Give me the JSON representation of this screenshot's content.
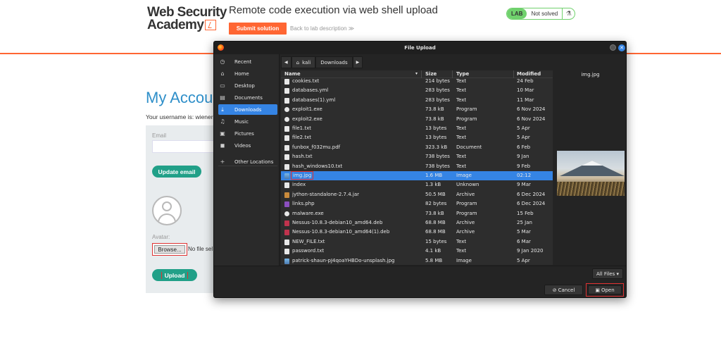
{
  "header": {
    "logo_line1": "Web Security",
    "logo_line2": "Academy",
    "lab_title": "Remote code execution via web shell upload",
    "submit_label": "Submit solution",
    "back_link": "Back to lab description",
    "back_arrow": "≫",
    "lab_tag": "LAB",
    "lab_status": "Not solved",
    "flask_icon": "⚗"
  },
  "account": {
    "title": "My Accou",
    "username_text": "Your username is: wiener",
    "email_label": "Email",
    "update_label": "Update email",
    "avatar_label": "Avatar:",
    "browse_label": "Browse...",
    "no_file_text": "No file sel",
    "upload_label": "Upload"
  },
  "dialog": {
    "title": "File Upload",
    "close_glyph": "✕",
    "sidebar": [
      {
        "icon": "◷",
        "icon_name": "recent-icon",
        "label": "Recent"
      },
      {
        "icon": "⌂",
        "icon_name": "home-icon",
        "label": "Home"
      },
      {
        "icon": "▭",
        "icon_name": "desktop-icon",
        "label": "Desktop"
      },
      {
        "icon": "▤",
        "icon_name": "documents-icon",
        "label": "Documents"
      },
      {
        "icon": "⤓",
        "icon_name": "downloads-icon",
        "label": "Downloads"
      },
      {
        "icon": "♫",
        "icon_name": "music-icon",
        "label": "Music"
      },
      {
        "icon": "▣",
        "icon_name": "pictures-icon",
        "label": "Pictures"
      },
      {
        "icon": "◼",
        "icon_name": "videos-icon",
        "label": "Videos"
      },
      {
        "icon": "+",
        "icon_name": "other-locations-icon",
        "label": "Other Locations"
      }
    ],
    "path": {
      "back": "◀",
      "home_icon": "⌂",
      "home_label": "kali",
      "current": "Downloads",
      "forward": "▶"
    },
    "columns": {
      "name": "Name",
      "size": "Size",
      "type": "Type",
      "modified": "Modified",
      "sort_glyph": "▾"
    },
    "files": [
      {
        "name": "cookies.txt",
        "size": "214 bytes",
        "type": "Text",
        "modified": "24 Feb",
        "icon": "text"
      },
      {
        "name": "databases.yml",
        "size": "283 bytes",
        "type": "Text",
        "modified": "10 Mar",
        "icon": "text"
      },
      {
        "name": "databases(1).yml",
        "size": "283 bytes",
        "type": "Text",
        "modified": "11 Mar",
        "icon": "text"
      },
      {
        "name": "exploit1.exe",
        "size": "73.8 kB",
        "type": "Program",
        "modified": "6 Nov 2024",
        "icon": "gear"
      },
      {
        "name": "exploit2.exe",
        "size": "73.8 kB",
        "type": "Program",
        "modified": "6 Nov 2024",
        "icon": "gear"
      },
      {
        "name": "file1.txt",
        "size": "13 bytes",
        "type": "Text",
        "modified": "5 Apr",
        "icon": "text"
      },
      {
        "name": "file2.txt",
        "size": "13 bytes",
        "type": "Text",
        "modified": "5 Apr",
        "icon": "text"
      },
      {
        "name": "funbox_f032mu.pdf",
        "size": "323.3 kB",
        "type": "Document",
        "modified": "6 Feb",
        "icon": "text"
      },
      {
        "name": "hash.txt",
        "size": "738 bytes",
        "type": "Text",
        "modified": "9 Jan",
        "icon": "text"
      },
      {
        "name": "hash_windows10.txt",
        "size": "738 bytes",
        "type": "Text",
        "modified": "9 Feb",
        "icon": "text"
      },
      {
        "name": "img.jpg",
        "size": "1.6 MB",
        "type": "Image",
        "modified": "02:12",
        "icon": "img"
      },
      {
        "name": "index",
        "size": "1.3 kB",
        "type": "Unknown",
        "modified": "9 Mar",
        "icon": "text"
      },
      {
        "name": "jython-standalone-2.7.4.jar",
        "size": "50.5 MB",
        "type": "Archive",
        "modified": "6 Dec 2024",
        "icon": "arch"
      },
      {
        "name": "links.php",
        "size": "82 bytes",
        "type": "Program",
        "modified": "6 Dec 2024",
        "icon": "php"
      },
      {
        "name": "malware.exe",
        "size": "73.8 kB",
        "type": "Program",
        "modified": "15 Feb",
        "icon": "gear"
      },
      {
        "name": "Nessus-10.8.3-debian10_amd64.deb",
        "size": "68.8 MB",
        "type": "Archive",
        "modified": "25 Jan",
        "icon": "deb"
      },
      {
        "name": "Nessus-10.8.3-debian10_amd64(1).deb",
        "size": "68.8 MB",
        "type": "Archive",
        "modified": "5 Mar",
        "icon": "deb"
      },
      {
        "name": "NEW_FILE.txt",
        "size": "15 bytes",
        "type": "Text",
        "modified": "6 Mar",
        "icon": "text"
      },
      {
        "name": "password.txt",
        "size": "4.1 kB",
        "type": "Text",
        "modified": "9 Jan 2020",
        "icon": "text"
      },
      {
        "name": "patrick-shaun-pJ4qoaYHBDo-unsplash.jpg",
        "size": "5.8 MB",
        "type": "Image",
        "modified": "5 Apr",
        "icon": "img"
      }
    ],
    "selected_file": "img.jpg",
    "preview_title": "img.jpg",
    "filter_label": "All Files ▾",
    "cancel_icon": "⊘",
    "cancel_label": "Cancel",
    "open_icon": "▣",
    "open_label": "Open"
  }
}
